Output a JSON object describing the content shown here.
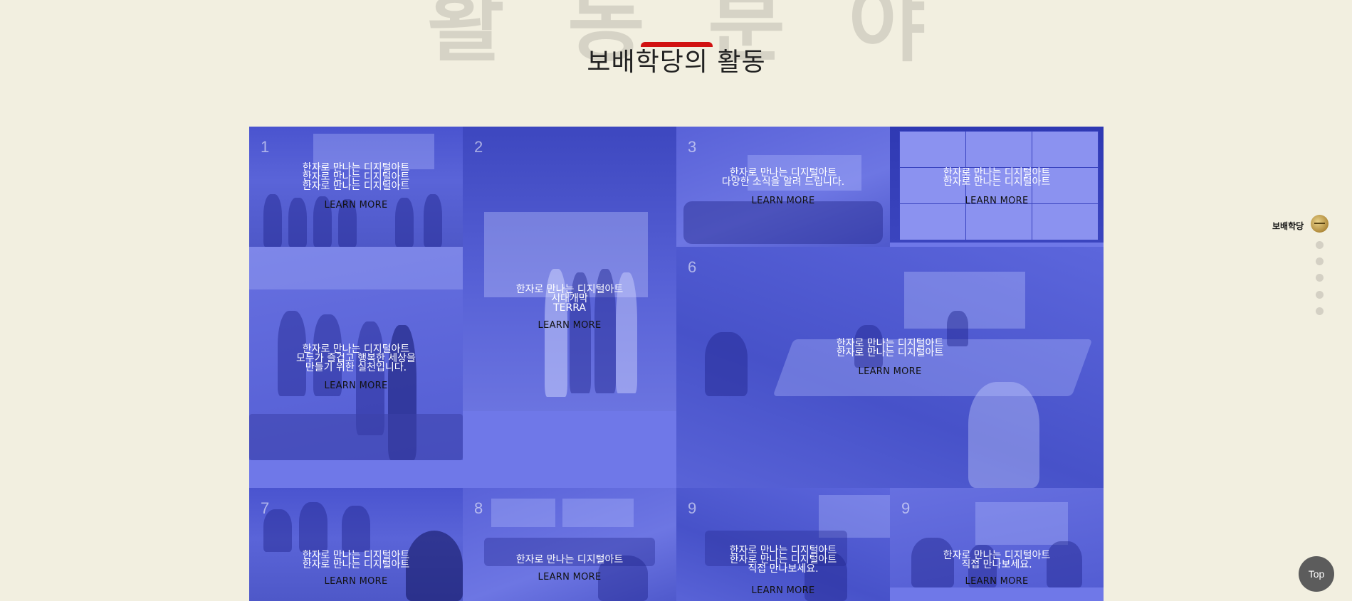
{
  "header": {
    "background_title_chars": [
      "활",
      "동",
      "분",
      "야"
    ],
    "title": "보배학당의 활동"
  },
  "tiles": [
    {
      "num": "1",
      "lines": [
        "한자로 만나는 디지털아트",
        "한자로 만나는 디지털아트",
        "한자로 만나는 디지털아트"
      ],
      "more": "LEARN MORE"
    },
    {
      "num": "2",
      "lines": [
        "한자로 만나는 디지털아트",
        "시대개막",
        "TERRA"
      ],
      "more": "LEARN MORE"
    },
    {
      "num": "3",
      "lines": [
        "한자로 만나는 디지털아트",
        "다양한 소식을 알려 드립니다."
      ],
      "more": "LEARN MORE"
    },
    {
      "num": "",
      "lines": [
        "한자로 만나는 디지털아트",
        "한자로 만나는 디지털아트"
      ],
      "more": "LEARN MORE"
    },
    {
      "num": "",
      "lines": [
        "한자로 만나는 디지털아트",
        "모두가 즐겁고 행복한 세상을",
        "만들기 위한 실천입니다."
      ],
      "more": "LEARN MORE"
    },
    {
      "num": "6",
      "lines": [
        "한자로 만나는 디지털아트",
        "한자로 만나는 디지털아트"
      ],
      "more": "LEARN MORE"
    },
    {
      "num": "7",
      "lines": [
        "한자로 만나는 디지털아트",
        "한자로 만나는 디지털아트"
      ],
      "more": "LEARN MORE"
    },
    {
      "num": "8",
      "lines": [
        "한자로 만나는 디지털아트"
      ],
      "more": "LEARN MORE"
    },
    {
      "num": "9",
      "lines": [
        "한자로 만나는 디지털아트",
        "한자로 만나는 디지털아트",
        "직접 만나보세요."
      ],
      "more": "LEARN MORE"
    },
    {
      "num": "9",
      "lines": [
        "한자로 만나는 디지털아트",
        "직접 만나보세요."
      ],
      "more": "LEARN MORE"
    }
  ],
  "side_nav": {
    "brand": "보배학당",
    "dots": 5
  },
  "top_button": "Top"
}
